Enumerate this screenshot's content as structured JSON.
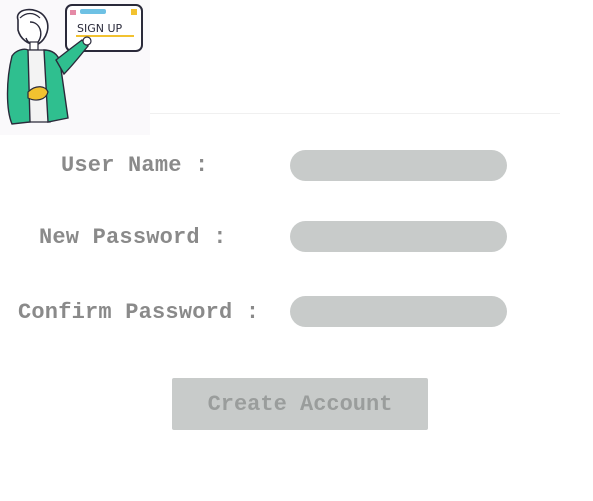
{
  "illustration": {
    "sign_text": "SIGN UP",
    "colors": {
      "jacket": "#2fbf8f",
      "sign_border": "#2a2a3a",
      "accent_blue": "#6ec1e4",
      "accent_pink": "#e58aa6",
      "accent_yellow": "#f2c230"
    }
  },
  "form": {
    "username_label": "User Name :",
    "new_password_label": "New Password :",
    "confirm_password_label": "Confirm Password :",
    "username_value": "",
    "new_password_value": "",
    "confirm_password_value": "",
    "submit_label": "Create Account"
  },
  "colors": {
    "label_text": "#8a8a8a",
    "input_background": "#c8cbca",
    "button_background": "#c8cbca",
    "button_text": "#9a9d9c"
  }
}
